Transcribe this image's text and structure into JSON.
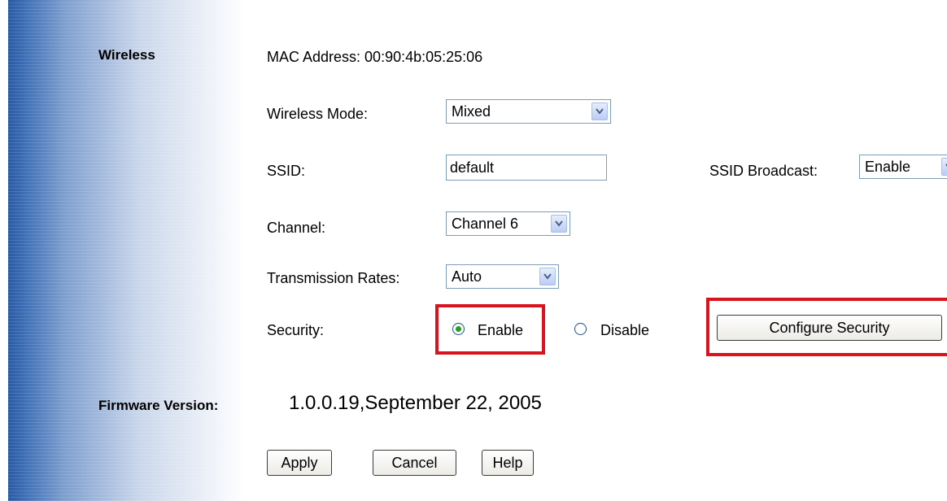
{
  "section_title": "Wireless",
  "mac_address": "MAC Address: 00:90:4b:05:25:06",
  "wireless_mode": {
    "label": "Wireless Mode:",
    "value": "Mixed"
  },
  "ssid": {
    "label": "SSID:",
    "value": "default"
  },
  "ssid_broadcast": {
    "label": "SSID Broadcast:",
    "value": "Enable"
  },
  "channel": {
    "label": "Channel:",
    "value": "Channel 6"
  },
  "transmission_rates": {
    "label": "Transmission Rates:",
    "value": "Auto"
  },
  "security": {
    "label": "Security:",
    "enable_label": "Enable",
    "disable_label": "Disable",
    "selected": "Enable",
    "configure_button": "Configure Security"
  },
  "firmware": {
    "label": "Firmware Version:",
    "value": "1.0.0.19,September 22, 2005"
  },
  "buttons": {
    "apply": "Apply",
    "cancel": "Cancel",
    "help": "Help"
  },
  "colors": {
    "highlight": "#d9141c",
    "sidebar": "#1d4f9a",
    "radio_selected": "#21a121"
  }
}
